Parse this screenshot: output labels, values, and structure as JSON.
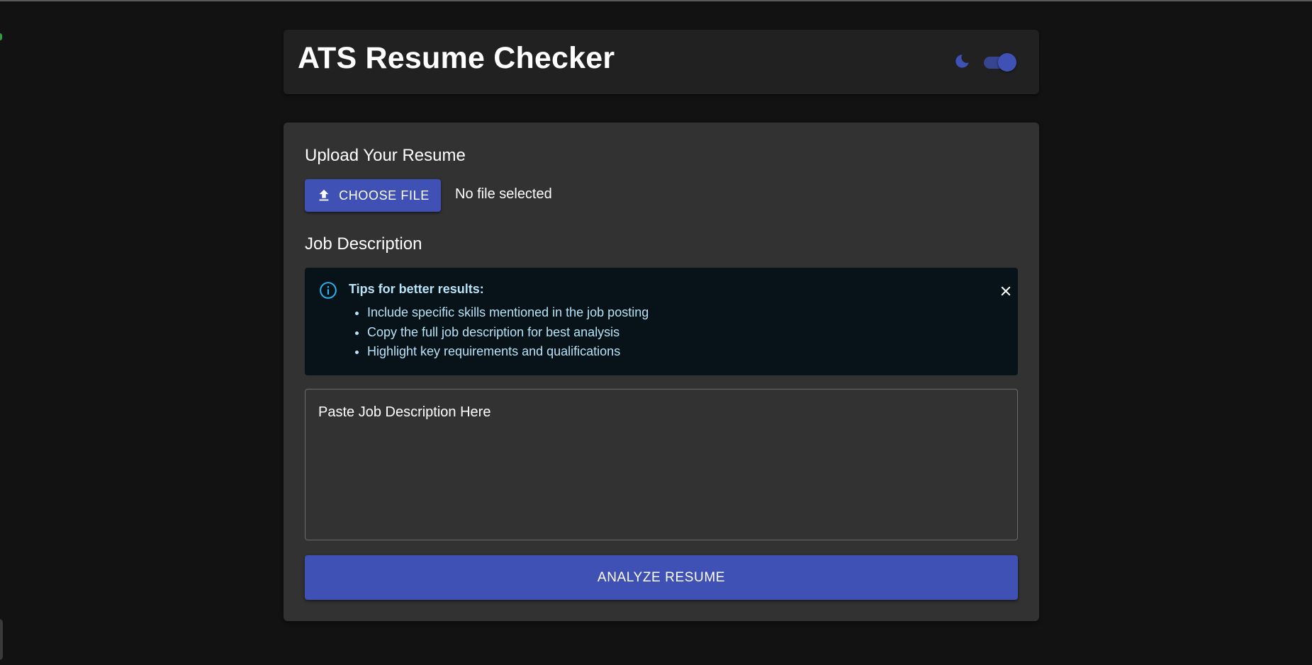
{
  "app": {
    "title": "ATS Resume Checker"
  },
  "theme": {
    "mode_icon": "moon-icon",
    "dark_mode_enabled": true,
    "accent_color": "#3f51b5",
    "background_color": "#121212"
  },
  "upload": {
    "heading": "Upload Your Resume",
    "button_label": "CHOOSE FILE",
    "button_icon": "upload-icon",
    "file_status": "No file selected"
  },
  "job": {
    "heading": "Job Description",
    "tips": {
      "icon": "info-icon",
      "title": "Tips for better results:",
      "items": [
        "Include specific skills mentioned in the job posting",
        "Copy the full job description for best analysis",
        "Highlight key requirements and qualifications"
      ],
      "close_icon": "close-icon"
    },
    "textarea": {
      "placeholder": "Paste Job Description Here",
      "value": ""
    }
  },
  "actions": {
    "analyze_label": "ANALYZE RESUME"
  }
}
